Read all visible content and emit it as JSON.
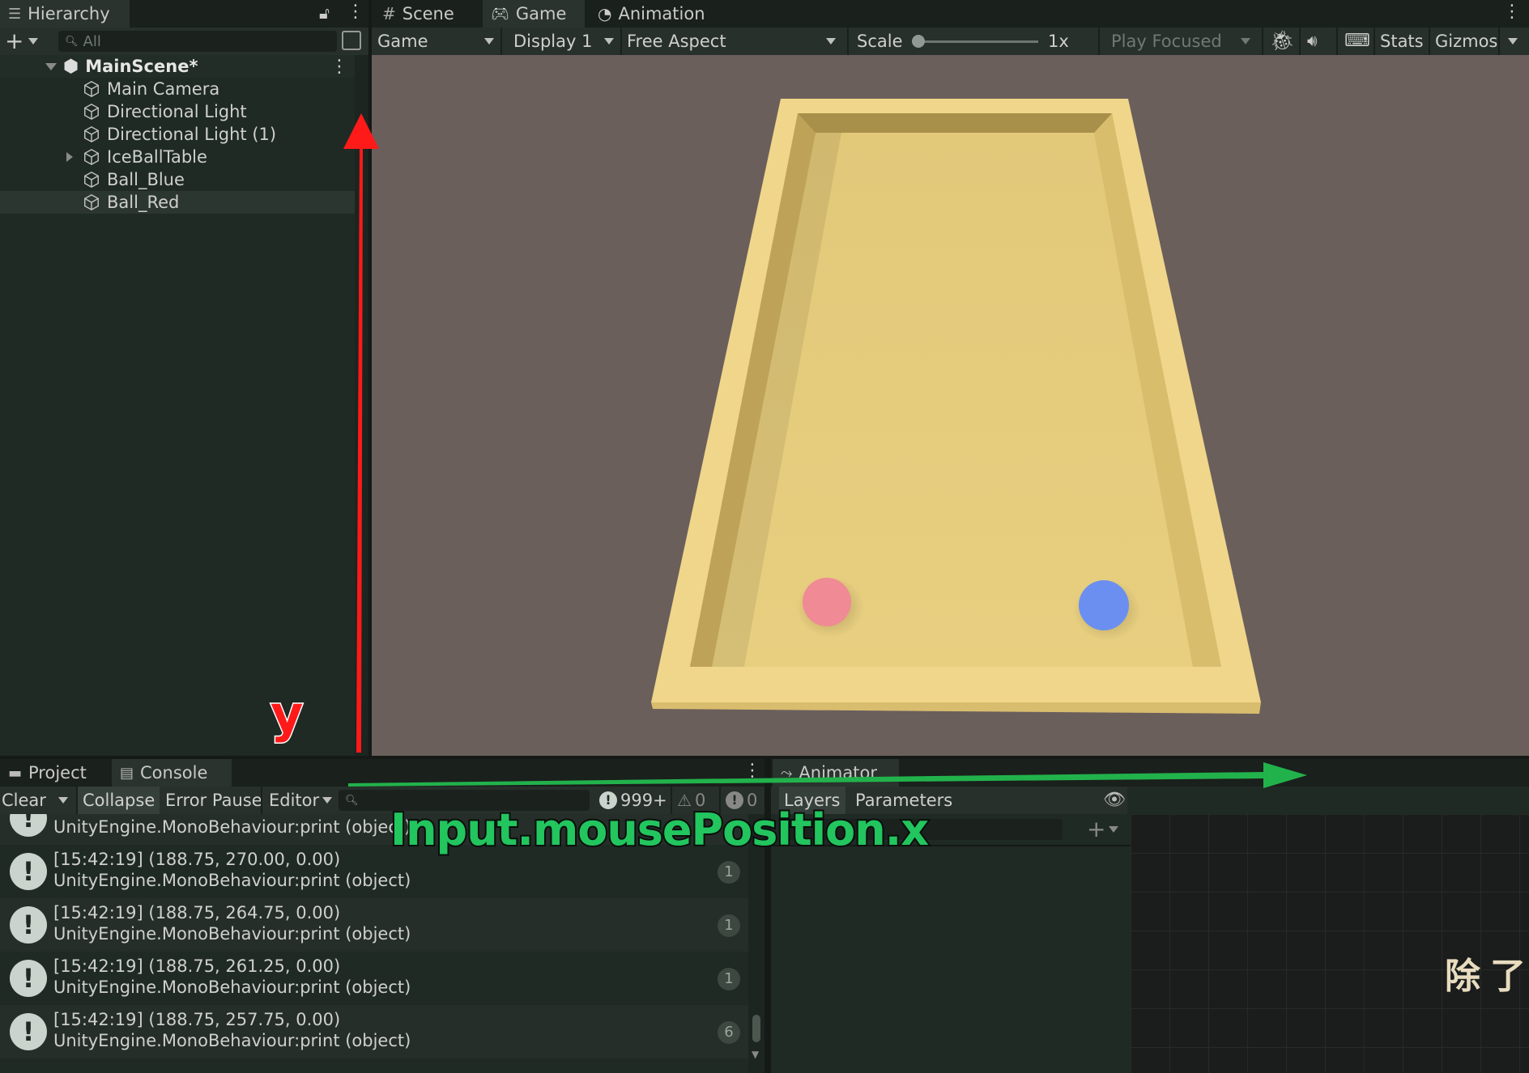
{
  "hierarchy": {
    "tab_label": "Hierarchy",
    "search_placeholder": "All",
    "scene_name": "MainScene*",
    "items": [
      {
        "label": "Main Camera"
      },
      {
        "label": "Directional Light"
      },
      {
        "label": "Directional Light (1)"
      },
      {
        "label": "IceBallTable"
      },
      {
        "label": "Ball_Blue"
      },
      {
        "label": "Ball_Red"
      }
    ]
  },
  "game_panel": {
    "tabs": [
      {
        "label": "Scene"
      },
      {
        "label": "Game"
      },
      {
        "label": "Animation"
      }
    ],
    "toolbar": {
      "game_dropdown": "Game",
      "display_dropdown": "Display 1",
      "aspect_dropdown": "Free Aspect",
      "scale_label": "Scale",
      "scale_value": "1x",
      "play_mode": "Play Focused",
      "stats_label": "Stats",
      "gizmos_label": "Gizmos"
    },
    "viewport": {
      "background_color": "#6b5f5c",
      "table_color": "#e8cc7c",
      "ball_red_color": "#f08a94",
      "ball_blue_color": "#6b8ff0"
    }
  },
  "bottom_left": {
    "tabs": [
      {
        "label": "Project"
      },
      {
        "label": "Console"
      }
    ],
    "toolbar": {
      "clear_label": "Clear",
      "collapse_label": "Collapse",
      "error_pause_label": "Error Pause",
      "editor_label": "Editor",
      "info_count": "999+",
      "warning_count": "0",
      "error_count": "0"
    },
    "logs": [
      {
        "line1": "",
        "line2": "UnityEngine.MonoBehaviour:print (object)",
        "count": ""
      },
      {
        "line1": "[15:42:19] (188.75, 270.00, 0.00)",
        "line2": "UnityEngine.MonoBehaviour:print (object)",
        "count": "1"
      },
      {
        "line1": "[15:42:19] (188.75, 264.75, 0.00)",
        "line2": "UnityEngine.MonoBehaviour:print (object)",
        "count": "1"
      },
      {
        "line1": "[15:42:19] (188.75, 261.25, 0.00)",
        "line2": "UnityEngine.MonoBehaviour:print (object)",
        "count": "1"
      },
      {
        "line1": "[15:42:19] (188.75, 257.75, 0.00)",
        "line2": "UnityEngine.MonoBehaviour:print (object)",
        "count": "6"
      }
    ]
  },
  "animator": {
    "tab_label": "Animator",
    "layers_label": "Layers",
    "parameters_label": "Parameters"
  },
  "annotations": {
    "y_label": "y",
    "x_label": "Input.mousePosition.x",
    "caption_cjk": "除了你",
    "y_arrow_color": "#ff1a1a",
    "x_arrow_color": "#22b24c"
  }
}
